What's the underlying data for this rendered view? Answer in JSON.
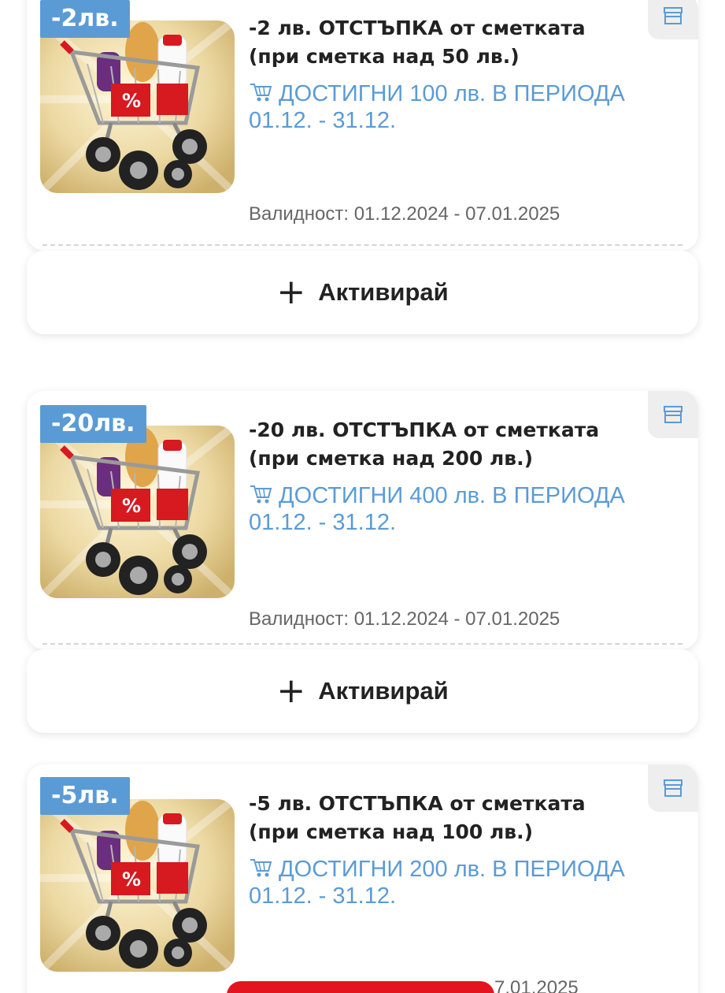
{
  "coupons": [
    {
      "badge": "-2лв.",
      "title": "-2 лв. ОТСТЪПКА от сметката (при сметка над 50 лв.)",
      "promo": "ДОСТИГНИ 100 лв. В ПЕРИОДА 01.12. - 31.12.",
      "validity": "Валидност: 01.12.2024 - 07.01.2025",
      "activate_label": "Активирай"
    },
    {
      "badge": "-20лв.",
      "title": "-20 лв. ОТСТЪПКА от сметката (при сметка над 200 лв.)",
      "promo": "ДОСТИГНИ 400 лв. В ПЕРИОДА 01.12. - 31.12.",
      "validity": "Валидност: 01.12.2024 - 07.01.2025",
      "activate_label": "Активирай"
    },
    {
      "badge": "-5лв.",
      "title": "-5 лв. ОТСТЪПКА от сметката (при сметка над 100 лв.)",
      "promo": "ДОСТИГНИ 200 лв. В ПЕРИОДА 01.12. - 31.12."
    }
  ],
  "partial_validity": "7.01.2025",
  "icons": {
    "store": "store-icon",
    "cart": "cart-icon",
    "plus": "plus-icon"
  },
  "colors": {
    "accent_blue": "#5b9bd5",
    "brand_red": "#e3151f",
    "text_dark": "#222222",
    "text_muted": "#666666"
  }
}
